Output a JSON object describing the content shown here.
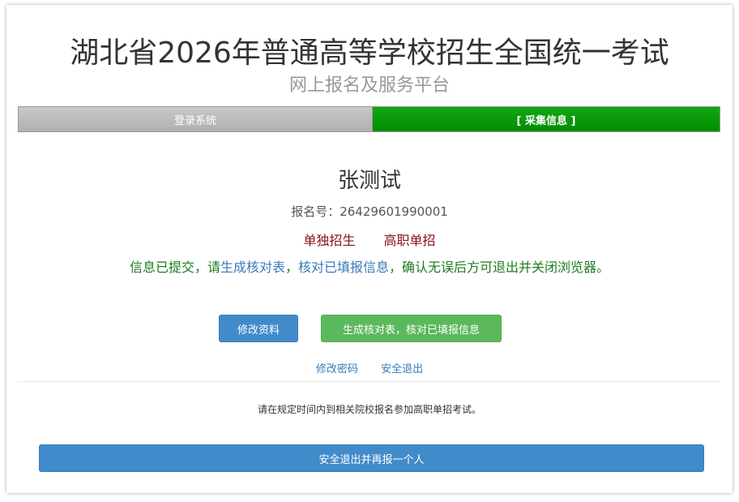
{
  "header": {
    "title": "湖北省2026年普通高等学校招生全国统一考试",
    "subtitle": "网上报名及服务平台"
  },
  "steps": [
    {
      "label": "登录系统",
      "state": "done"
    },
    {
      "label": "[ 采集信息 ]",
      "state": "active"
    }
  ],
  "student": {
    "name": "张测试",
    "reg_label": "报名号：",
    "reg_number": "26429601990001",
    "tags": [
      "单独招生",
      "高职单招"
    ]
  },
  "notice": {
    "part1": "信息已提交，请",
    "link1": "生成核对表",
    "part2": "，",
    "link2": "核对已填报信息",
    "part3": "，确认无误后方可退出并关闭浏览器。"
  },
  "buttons": {
    "edit": "修改资料",
    "generate": "生成核对表，核对已填报信息"
  },
  "links": {
    "change_password": "修改密码",
    "logout": "安全退出"
  },
  "hint": "请在规定时间内到相关院校报名参加高职单招考试。",
  "exit_button": "安全退出并再报一个人",
  "colors": {
    "primary": "#428bca",
    "success": "#5cb85c",
    "step_active": "#079607",
    "tag_red": "#8b1010",
    "notice_green": "#1f7a1f"
  }
}
